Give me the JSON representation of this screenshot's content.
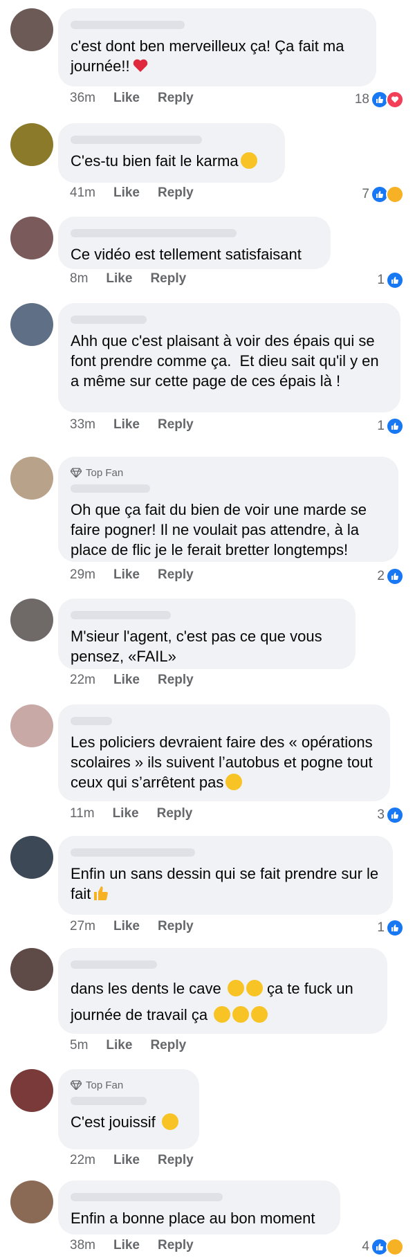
{
  "actions": {
    "like": "Like",
    "reply": "Reply"
  },
  "top_fan": "Top Fan",
  "comments": [
    {
      "time": "36m",
      "text": "c'est dont ben merveilleux ça! Ça fait ma journée!!",
      "emoji_end": "heart-emoji",
      "reaction_count": "18",
      "reactions": [
        "like",
        "heart"
      ],
      "avatar_color": "#6b5a55"
    },
    {
      "time": "41m",
      "text": "C'es-tu bien fait le karma",
      "emoji_end": "rofl-emoji",
      "reaction_count": "7",
      "reactions": [
        "like",
        "haha"
      ],
      "avatar_color": "#8a7a2a"
    },
    {
      "time": "8m",
      "text": "Ce vidéo est tellement satisfaisant",
      "reaction_count": "1",
      "reactions": [
        "like"
      ],
      "avatar_color": "#7a5a5a"
    },
    {
      "time": "33m",
      "text": "Ahh que c'est plaisant à voir des épais qui se font prendre comme ça.  Et dieu sait qu'il y en a même sur cette page de ces épais là !",
      "reaction_count": "1",
      "reactions": [
        "like"
      ],
      "avatar_color": "#5f6f86"
    },
    {
      "time": "29m",
      "text": "Oh que ça fait du bien de voir une marde se faire pogner! Il ne voulait pas attendre, à la place de flic je le ferait bretter longtemps!",
      "reaction_count": "2",
      "reactions": [
        "like"
      ],
      "top_fan": true,
      "avatar_color": "#b9a28a"
    },
    {
      "time": "22m",
      "text": "M'sieur l'agent, c'est pas ce que vous pensez, «FAIL»",
      "reaction_count": "",
      "reactions": [],
      "avatar_color": "#6f6a68"
    },
    {
      "time": "11m",
      "text": "Les policiers devraient faire des « opérations scolaires » ils suivent l’autobus et pogne tout ceux qui s’arrêtent pas",
      "emoji_end": "joy-emoji",
      "reaction_count": "3",
      "reactions": [
        "like"
      ],
      "avatar_color": "#c9a9a5"
    },
    {
      "time": "27m",
      "text": "Enfin un sans dessin qui se fait prendre sur le fait",
      "emoji_end": "thumbs-up-emoji",
      "reaction_count": "1",
      "reactions": [
        "like"
      ],
      "avatar_color": "#3c4856"
    },
    {
      "time": "5m",
      "text": "dans les dents le cave",
      "reaction_count": "",
      "reactions": [],
      "avatar_color": "#5e4a46"
    },
    {
      "time": "22m",
      "text": "C'est jouissif",
      "emoji_end": "tongue-emoji",
      "reaction_count": "",
      "reactions": [],
      "top_fan": true,
      "avatar_color": "#7a3a3a"
    },
    {
      "time": "38m",
      "text": "Enfin a bonne place au bon moment",
      "reaction_count": "4",
      "reactions": [
        "like",
        "haha"
      ],
      "avatar_color": "#8a6a55"
    }
  ],
  "comment9_line2": "ça te fuck un journée de travail ça"
}
